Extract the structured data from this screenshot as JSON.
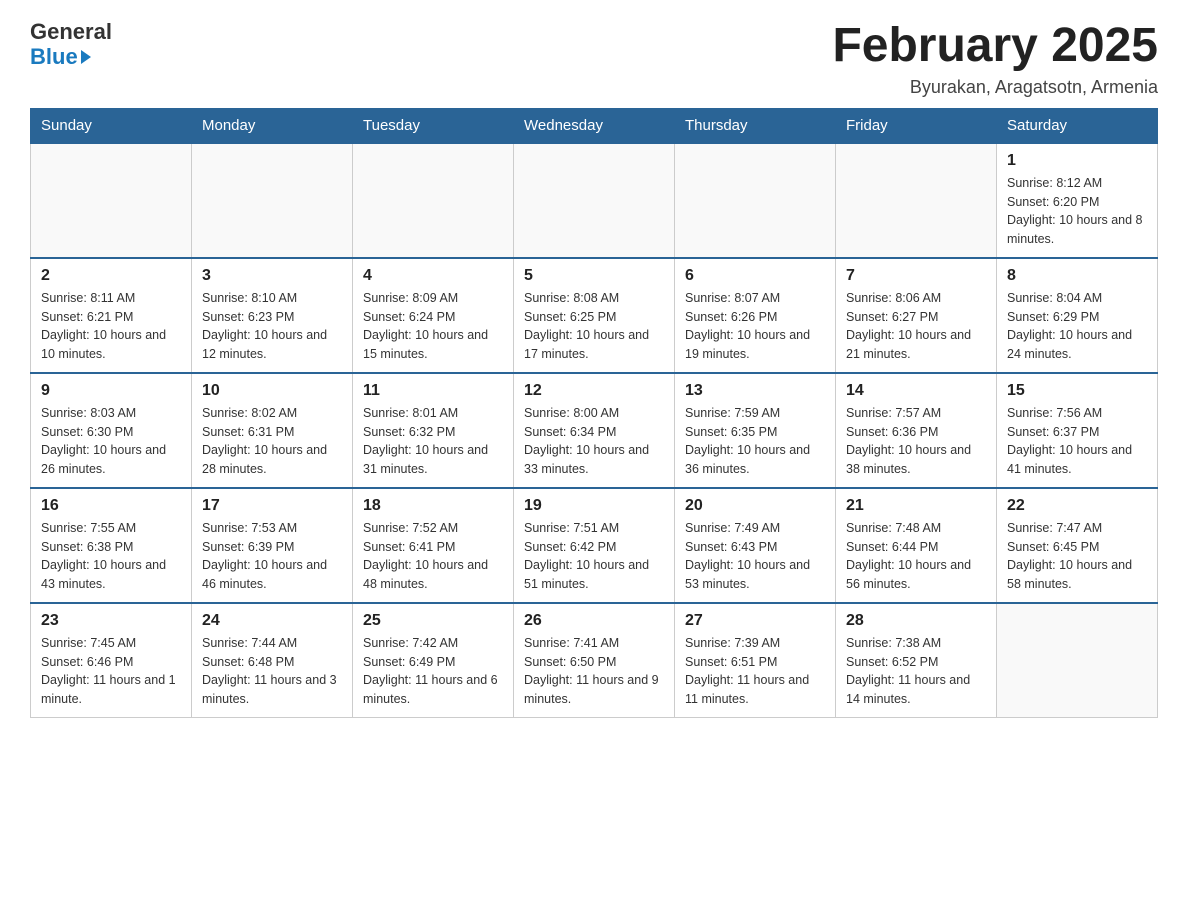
{
  "header": {
    "logo_general": "General",
    "logo_blue": "Blue",
    "month_title": "February 2025",
    "location": "Byurakan, Aragatsotn, Armenia"
  },
  "days_of_week": [
    "Sunday",
    "Monday",
    "Tuesday",
    "Wednesday",
    "Thursday",
    "Friday",
    "Saturday"
  ],
  "weeks": [
    [
      {
        "day": "",
        "info": ""
      },
      {
        "day": "",
        "info": ""
      },
      {
        "day": "",
        "info": ""
      },
      {
        "day": "",
        "info": ""
      },
      {
        "day": "",
        "info": ""
      },
      {
        "day": "",
        "info": ""
      },
      {
        "day": "1",
        "info": "Sunrise: 8:12 AM\nSunset: 6:20 PM\nDaylight: 10 hours and 8 minutes."
      }
    ],
    [
      {
        "day": "2",
        "info": "Sunrise: 8:11 AM\nSunset: 6:21 PM\nDaylight: 10 hours and 10 minutes."
      },
      {
        "day": "3",
        "info": "Sunrise: 8:10 AM\nSunset: 6:23 PM\nDaylight: 10 hours and 12 minutes."
      },
      {
        "day": "4",
        "info": "Sunrise: 8:09 AM\nSunset: 6:24 PM\nDaylight: 10 hours and 15 minutes."
      },
      {
        "day": "5",
        "info": "Sunrise: 8:08 AM\nSunset: 6:25 PM\nDaylight: 10 hours and 17 minutes."
      },
      {
        "day": "6",
        "info": "Sunrise: 8:07 AM\nSunset: 6:26 PM\nDaylight: 10 hours and 19 minutes."
      },
      {
        "day": "7",
        "info": "Sunrise: 8:06 AM\nSunset: 6:27 PM\nDaylight: 10 hours and 21 minutes."
      },
      {
        "day": "8",
        "info": "Sunrise: 8:04 AM\nSunset: 6:29 PM\nDaylight: 10 hours and 24 minutes."
      }
    ],
    [
      {
        "day": "9",
        "info": "Sunrise: 8:03 AM\nSunset: 6:30 PM\nDaylight: 10 hours and 26 minutes."
      },
      {
        "day": "10",
        "info": "Sunrise: 8:02 AM\nSunset: 6:31 PM\nDaylight: 10 hours and 28 minutes."
      },
      {
        "day": "11",
        "info": "Sunrise: 8:01 AM\nSunset: 6:32 PM\nDaylight: 10 hours and 31 minutes."
      },
      {
        "day": "12",
        "info": "Sunrise: 8:00 AM\nSunset: 6:34 PM\nDaylight: 10 hours and 33 minutes."
      },
      {
        "day": "13",
        "info": "Sunrise: 7:59 AM\nSunset: 6:35 PM\nDaylight: 10 hours and 36 minutes."
      },
      {
        "day": "14",
        "info": "Sunrise: 7:57 AM\nSunset: 6:36 PM\nDaylight: 10 hours and 38 minutes."
      },
      {
        "day": "15",
        "info": "Sunrise: 7:56 AM\nSunset: 6:37 PM\nDaylight: 10 hours and 41 minutes."
      }
    ],
    [
      {
        "day": "16",
        "info": "Sunrise: 7:55 AM\nSunset: 6:38 PM\nDaylight: 10 hours and 43 minutes."
      },
      {
        "day": "17",
        "info": "Sunrise: 7:53 AM\nSunset: 6:39 PM\nDaylight: 10 hours and 46 minutes."
      },
      {
        "day": "18",
        "info": "Sunrise: 7:52 AM\nSunset: 6:41 PM\nDaylight: 10 hours and 48 minutes."
      },
      {
        "day": "19",
        "info": "Sunrise: 7:51 AM\nSunset: 6:42 PM\nDaylight: 10 hours and 51 minutes."
      },
      {
        "day": "20",
        "info": "Sunrise: 7:49 AM\nSunset: 6:43 PM\nDaylight: 10 hours and 53 minutes."
      },
      {
        "day": "21",
        "info": "Sunrise: 7:48 AM\nSunset: 6:44 PM\nDaylight: 10 hours and 56 minutes."
      },
      {
        "day": "22",
        "info": "Sunrise: 7:47 AM\nSunset: 6:45 PM\nDaylight: 10 hours and 58 minutes."
      }
    ],
    [
      {
        "day": "23",
        "info": "Sunrise: 7:45 AM\nSunset: 6:46 PM\nDaylight: 11 hours and 1 minute."
      },
      {
        "day": "24",
        "info": "Sunrise: 7:44 AM\nSunset: 6:48 PM\nDaylight: 11 hours and 3 minutes."
      },
      {
        "day": "25",
        "info": "Sunrise: 7:42 AM\nSunset: 6:49 PM\nDaylight: 11 hours and 6 minutes."
      },
      {
        "day": "26",
        "info": "Sunrise: 7:41 AM\nSunset: 6:50 PM\nDaylight: 11 hours and 9 minutes."
      },
      {
        "day": "27",
        "info": "Sunrise: 7:39 AM\nSunset: 6:51 PM\nDaylight: 11 hours and 11 minutes."
      },
      {
        "day": "28",
        "info": "Sunrise: 7:38 AM\nSunset: 6:52 PM\nDaylight: 11 hours and 14 minutes."
      },
      {
        "day": "",
        "info": ""
      }
    ]
  ]
}
